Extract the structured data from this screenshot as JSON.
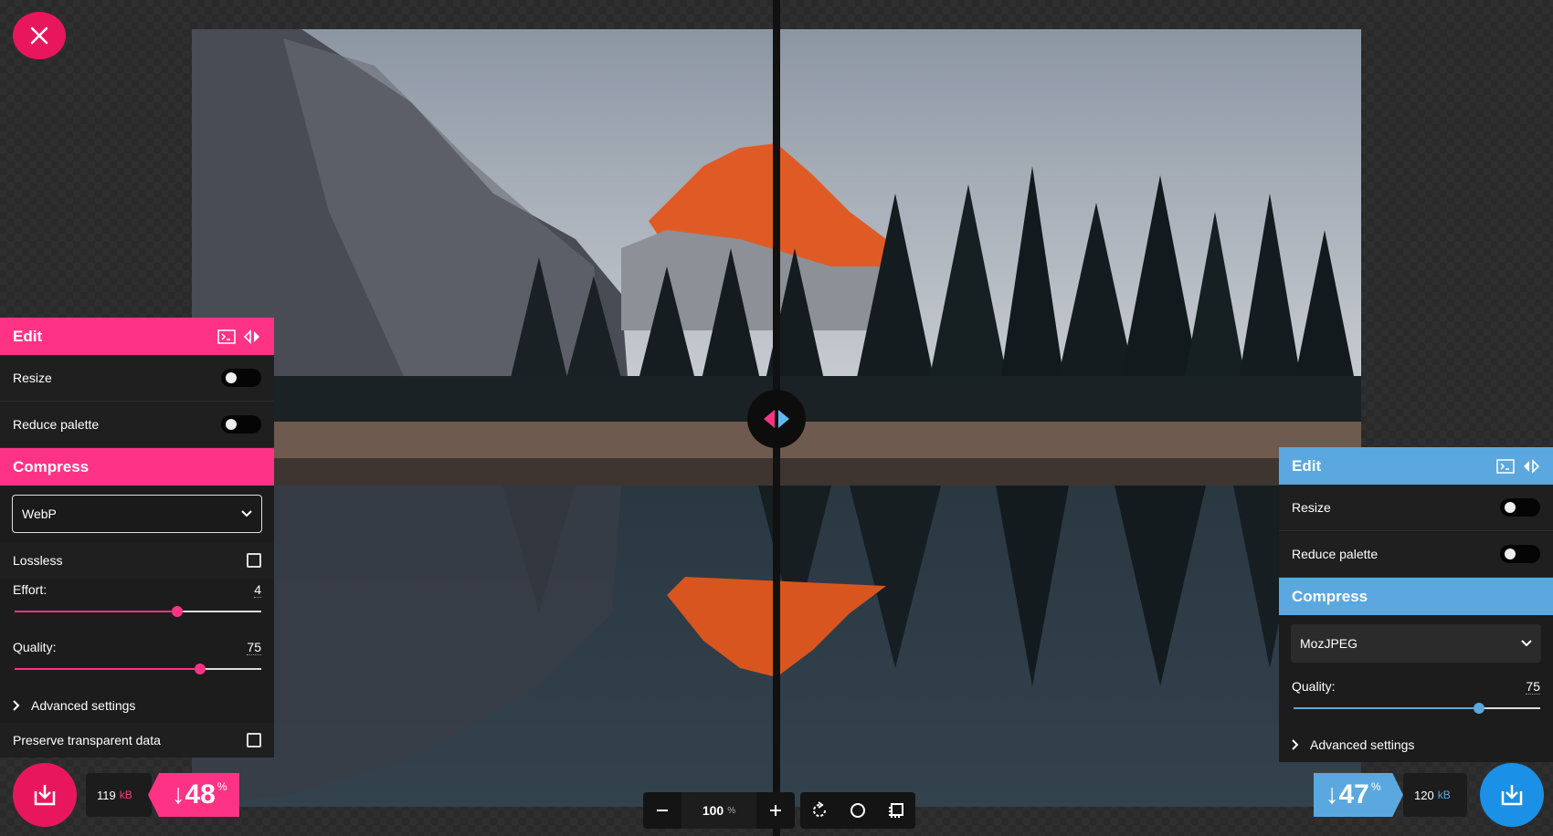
{
  "left_panel": {
    "edit_title": "Edit",
    "resize_label": "Resize",
    "reduce_palette_label": "Reduce palette",
    "compress_title": "Compress",
    "codec": "WebP",
    "lossless_label": "Lossless",
    "effort_label": "Effort:",
    "effort_value": "4",
    "effort_fraction": 0.66,
    "quality_label": "Quality:",
    "quality_value": "75",
    "quality_fraction": 0.75,
    "advanced_label": "Advanced settings",
    "preserve_label": "Preserve transparent data"
  },
  "right_panel": {
    "edit_title": "Edit",
    "resize_label": "Resize",
    "reduce_palette_label": "Reduce palette",
    "compress_title": "Compress",
    "codec": "MozJPEG",
    "quality_label": "Quality:",
    "quality_value": "75",
    "quality_fraction": 0.75,
    "advanced_label": "Advanced settings"
  },
  "left_result": {
    "size": "119",
    "unit": "kB",
    "reduction": "↓48",
    "pct_sign": "%"
  },
  "right_result": {
    "size": "120",
    "unit": "kB",
    "reduction": "↓47",
    "pct_sign": "%"
  },
  "zoom": {
    "value": "100",
    "unit": "%"
  },
  "colors": {
    "left_accent": "#ff3385",
    "right_accent": "#5aa8df",
    "close": "#e8175d"
  },
  "icons": [
    "close-icon",
    "terminal-icon",
    "swap-sides-icon",
    "download-icon",
    "minus-icon",
    "plus-icon",
    "rotate-icon",
    "background-toggle-icon",
    "fit-icon",
    "chevron-down-icon",
    "chevron-right-icon"
  ]
}
